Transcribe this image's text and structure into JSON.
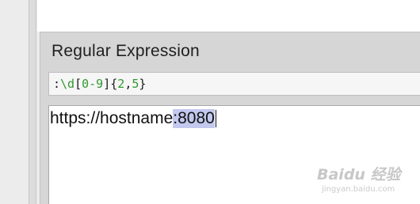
{
  "panel": {
    "title": "Regular Expression"
  },
  "regex": {
    "tokens": [
      {
        "text": ":",
        "kind": "colon"
      },
      {
        "text": "\\d",
        "kind": "escape"
      },
      {
        "text": "[",
        "kind": "bracket"
      },
      {
        "text": "0-9",
        "kind": "range"
      },
      {
        "text": "]{",
        "kind": "bracket"
      },
      {
        "text": "2",
        "kind": "num"
      },
      {
        "text": ",",
        "kind": "quant"
      },
      {
        "text": "5",
        "kind": "num"
      },
      {
        "text": "}",
        "kind": "quant"
      }
    ],
    "colors": {
      "token_green": "#2f9a2f",
      "token_dark": "#1a1a1a"
    }
  },
  "test_input": {
    "prefix": "https://hostname",
    "match": ":8080",
    "highlight_color": "#c3c8ee"
  },
  "watermark": {
    "logo": "Baidu 经验",
    "url": "jingyan.baidu.com"
  }
}
